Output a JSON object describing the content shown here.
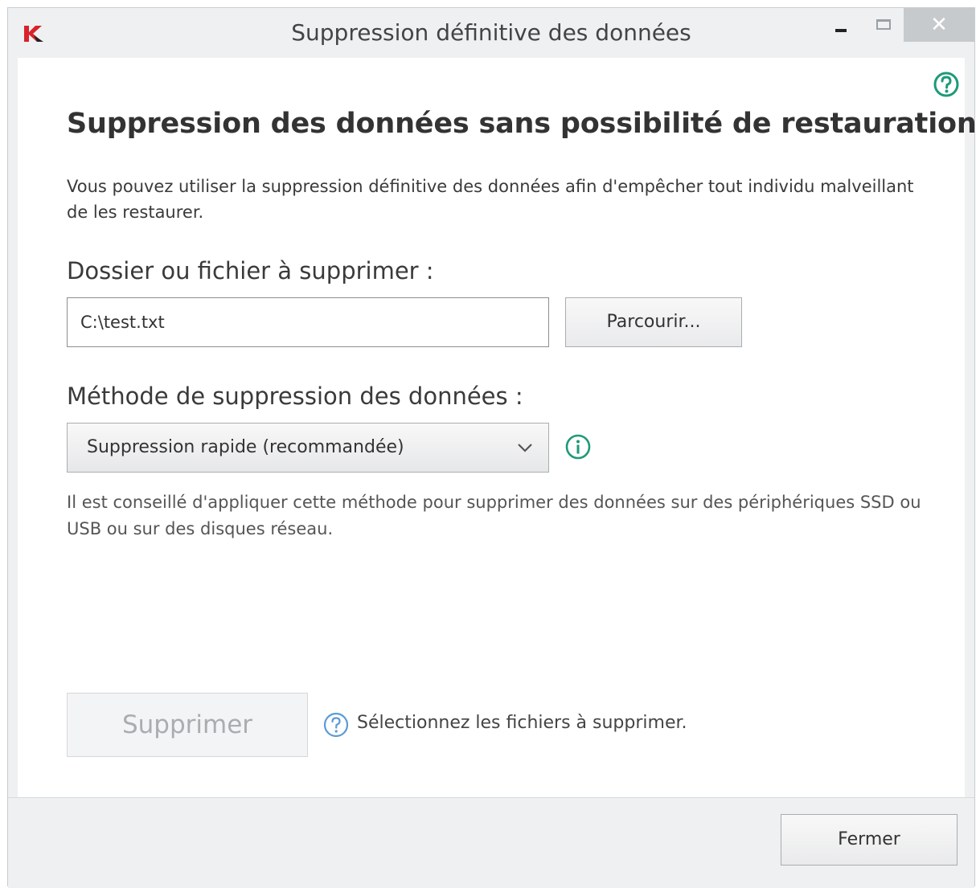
{
  "window": {
    "title": "Suppression définitive des données",
    "close_glyph": "✕"
  },
  "content": {
    "heading": "Suppression des données sans possibilité de restauration",
    "description": "Vous pouvez utiliser la suppression définitive des données afin d'empêcher tout individu malveillant de les restaurer.",
    "file_label": "Dossier ou fichier à supprimer :",
    "file_value": "C:\\test.txt",
    "browse_label": "Parcourir...",
    "method_label": "Méthode de suppression des données :",
    "method_selected": "Suppression rapide (recommandée)",
    "method_hint": "Il est conseillé d'appliquer cette méthode pour supprimer des données sur des périphériques SSD ou USB ou sur des disques réseau.",
    "delete_label": "Supprimer",
    "status_text": "Sélectionnez les fichiers à supprimer."
  },
  "footer": {
    "close_label": "Fermer"
  },
  "colors": {
    "accent_green": "#1e9a78",
    "info_blue": "#5b9bd5",
    "logo_red": "#d8232a"
  },
  "icons": [
    "kaspersky-logo-icon",
    "minimize-icon",
    "maximize-icon",
    "close-icon",
    "help-icon",
    "chevron-down-icon",
    "info-icon",
    "question-icon"
  ]
}
